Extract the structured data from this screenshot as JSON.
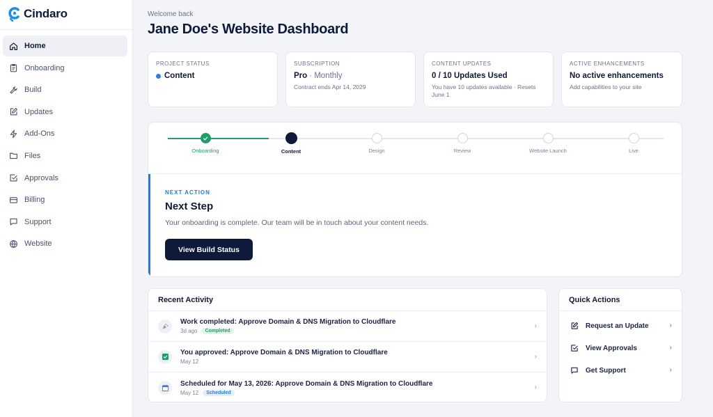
{
  "app": {
    "name": "Cindaro"
  },
  "sidebar": {
    "items": [
      {
        "label": "Home",
        "icon": "home-icon",
        "active": true
      },
      {
        "label": "Onboarding",
        "icon": "clipboard-icon"
      },
      {
        "label": "Build",
        "icon": "wrench-icon"
      },
      {
        "label": "Updates",
        "icon": "edit-icon"
      },
      {
        "label": "Add-Ons",
        "icon": "bolt-icon"
      },
      {
        "label": "Files",
        "icon": "folder-icon"
      },
      {
        "label": "Approvals",
        "icon": "check-square-icon"
      },
      {
        "label": "Billing",
        "icon": "credit-card-icon"
      },
      {
        "label": "Support",
        "icon": "chat-icon"
      },
      {
        "label": "Website",
        "icon": "globe-icon"
      }
    ]
  },
  "header": {
    "welcome": "Welcome back",
    "title": "Jane Doe's Website Dashboard"
  },
  "stats": {
    "project_status": {
      "label": "PROJECT STATUS",
      "value": "Content"
    },
    "subscription": {
      "label": "SUBSCRIPTION",
      "value": "Pro",
      "value_suffix": "· Monthly",
      "sub": "Contract ends Apr 14, 2029"
    },
    "content_updates": {
      "label": "CONTENT UPDATES",
      "value": "0 / 10 Updates Used",
      "sub": "You have 10 updates available · Resets June 1"
    },
    "enhancements": {
      "label": "ACTIVE ENHANCEMENTS",
      "value": "No active enhancements",
      "sub": "Add capabilities to your site"
    }
  },
  "progress": {
    "steps": [
      {
        "label": "Onboarding",
        "state": "done"
      },
      {
        "label": "Content",
        "state": "current"
      },
      {
        "label": "Design",
        "state": "upcoming"
      },
      {
        "label": "Review",
        "state": "upcoming"
      },
      {
        "label": "Website Launch",
        "state": "upcoming"
      },
      {
        "label": "Live",
        "state": "upcoming"
      }
    ],
    "next_action": {
      "kicker": "NEXT ACTION",
      "title": "Next Step",
      "description": "Your onboarding is complete. Our team will be in touch about your content needs.",
      "button": "View Build Status"
    }
  },
  "activity": {
    "title": "Recent Activity",
    "items": [
      {
        "title": "Work completed: Approve Domain & DNS Migration to Cloudflare",
        "time": "3d ago",
        "badge": "Completed",
        "icon": "party-icon"
      },
      {
        "title": "You approved: Approve Domain & DNS Migration to Cloudflare",
        "time": "May 12",
        "badge": "",
        "icon": "check-icon"
      },
      {
        "title": "Scheduled for May 13, 2026: Approve Domain & DNS Migration to Cloudflare",
        "time": "May 12",
        "badge": "Scheduled",
        "icon": "calendar-icon"
      }
    ]
  },
  "quick_actions": {
    "title": "Quick Actions",
    "items": [
      {
        "label": "Request an Update",
        "icon": "edit-icon"
      },
      {
        "label": "View Approvals",
        "icon": "check-square-icon"
      },
      {
        "label": "Get Support",
        "icon": "chat-icon"
      }
    ]
  },
  "colors": {
    "navy": "#0d1a3a",
    "green": "#1f9d6b",
    "blue": "#1c7fd1"
  }
}
